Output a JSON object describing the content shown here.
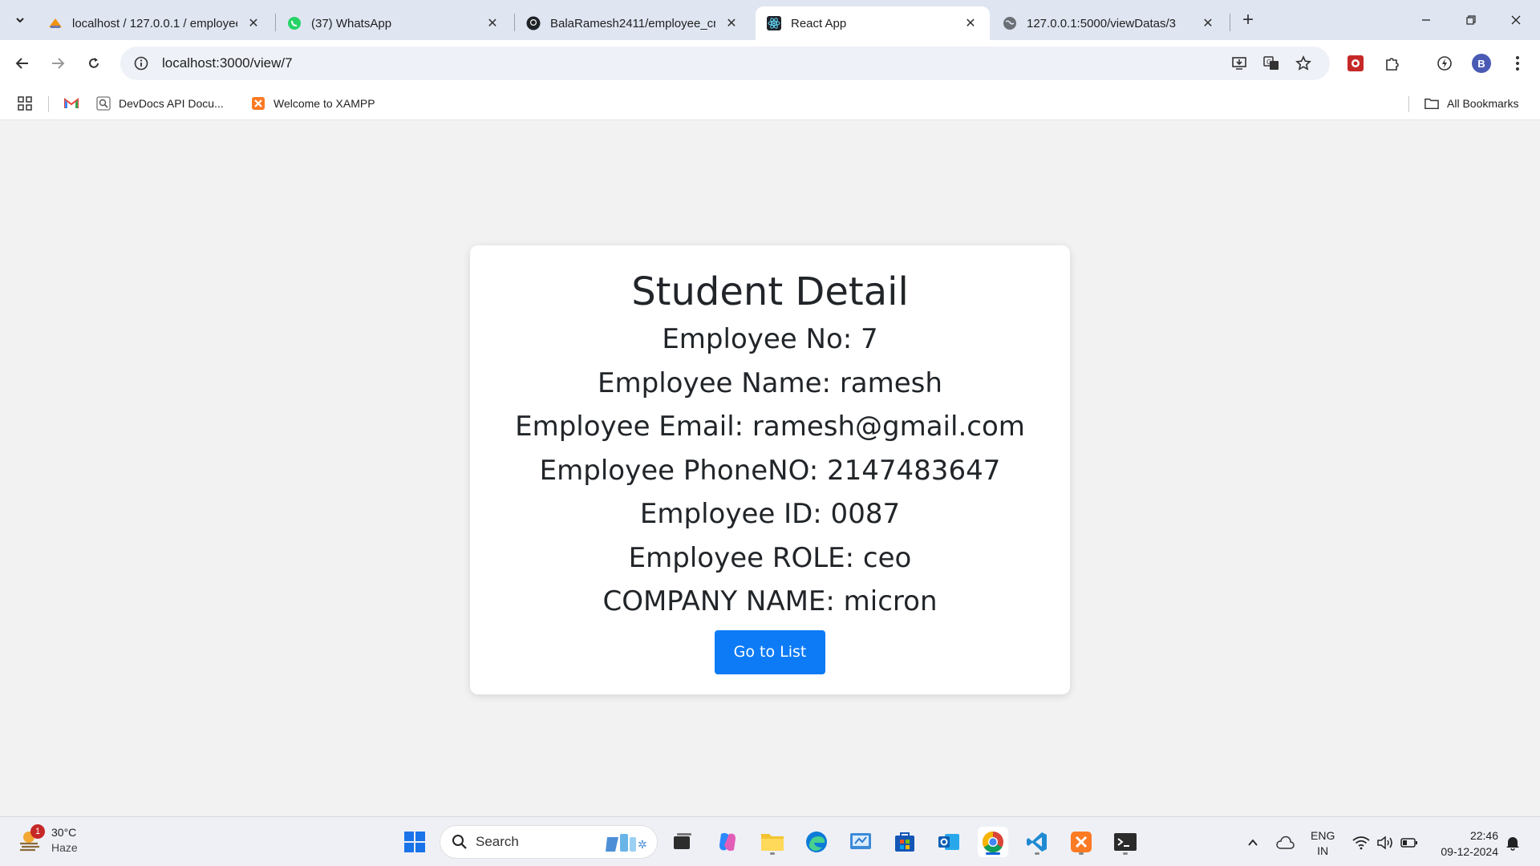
{
  "browser": {
    "tabs": [
      {
        "title": "localhost / 127.0.0.1 / employee",
        "favicon": "phpmyadmin-icon"
      },
      {
        "title": "(37) WhatsApp",
        "favicon": "whatsapp-icon"
      },
      {
        "title": "BalaRamesh2411/employee_cru",
        "favicon": "github-icon"
      },
      {
        "title": "React App",
        "favicon": "react-icon"
      },
      {
        "title": "127.0.0.1:5000/viewDatas/3",
        "favicon": "globe-icon"
      }
    ],
    "active_tab_index": 3,
    "url": "localhost:3000/view/7",
    "profile_initial": "B",
    "bookmarks": [
      {
        "label": "DevDocs API Docu..."
      },
      {
        "label": "Welcome to XAMPP"
      }
    ],
    "all_bookmarks_label": "All Bookmarks"
  },
  "page": {
    "heading": "Student Detail",
    "fields": [
      {
        "label": "Employee No: 7"
      },
      {
        "label": "Employee Name: ramesh"
      },
      {
        "label": "Employee Email: ramesh@gmail.com"
      },
      {
        "label": "Employee PhoneNO: 2147483647"
      },
      {
        "label": "Employee ID: 0087"
      },
      {
        "label": "Employee ROLE: ceo"
      },
      {
        "label": "COMPANY NAME: micron"
      }
    ],
    "button_label": "Go to List",
    "button_color": "#0d7bf6"
  },
  "taskbar": {
    "weather_temp": "30°C",
    "weather_desc": "Haze",
    "weather_badge": "1",
    "search_label": "Search",
    "lang_line1": "ENG",
    "lang_line2": "IN",
    "time": "22:46",
    "date": "09-12-2024"
  }
}
